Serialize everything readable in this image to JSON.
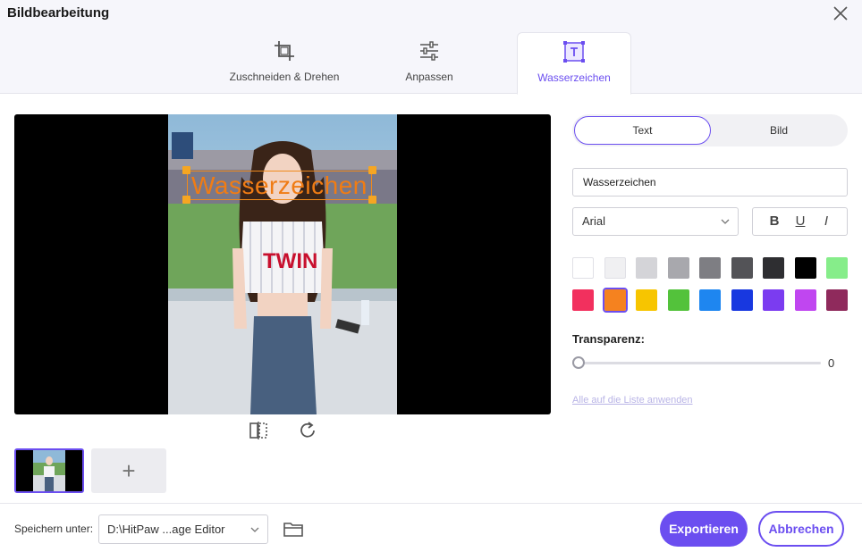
{
  "window": {
    "title": "Bildbearbeitung",
    "close_icon": "close-icon"
  },
  "tabs": [
    {
      "label": "Zuschneiden & Drehen",
      "icon": "crop-icon",
      "active": false
    },
    {
      "label": "Anpassen",
      "icon": "sliders-icon",
      "active": false
    },
    {
      "label": "Wasserzeichen",
      "icon": "watermark-icon",
      "active": true
    }
  ],
  "preview": {
    "watermark_text": "Wasserzeichen",
    "watermark_color": "#f07c14",
    "tools": [
      "mirror-icon",
      "rotate-icon"
    ]
  },
  "thumbnails": {
    "count": 1,
    "add_label": "+"
  },
  "panel": {
    "mode_text": "Text",
    "mode_image": "Bild",
    "text_value": "Wasserzeichen",
    "font": "Arial",
    "style_bold": "B",
    "style_underline": "U",
    "style_italic": "I",
    "colors_row1": [
      "#ffffff",
      "#f0f0f2",
      "#d4d4d8",
      "#a8a8ad",
      "#7e7e83",
      "#535357",
      "#2e2e31",
      "#000000",
      "#86ed8a"
    ],
    "colors_row2": [
      "#f2305e",
      "#f5821f",
      "#f7c500",
      "#53c23b",
      "#1e86f0",
      "#1838e0",
      "#7b3cf0",
      "#c046f0",
      "#8f2a5c"
    ],
    "selected_color": "#f5821f",
    "transparency_label": "Transparenz:",
    "transparency_value": "0",
    "transparency_fraction": 0,
    "apply_all": "Alle auf die Liste anwenden"
  },
  "footer": {
    "save_label": "Speichern unter:",
    "save_path": "D:\\HitPaw ...age Editor",
    "export": "Exportieren",
    "cancel": "Abbrechen"
  },
  "accent": "#6b4ef0"
}
